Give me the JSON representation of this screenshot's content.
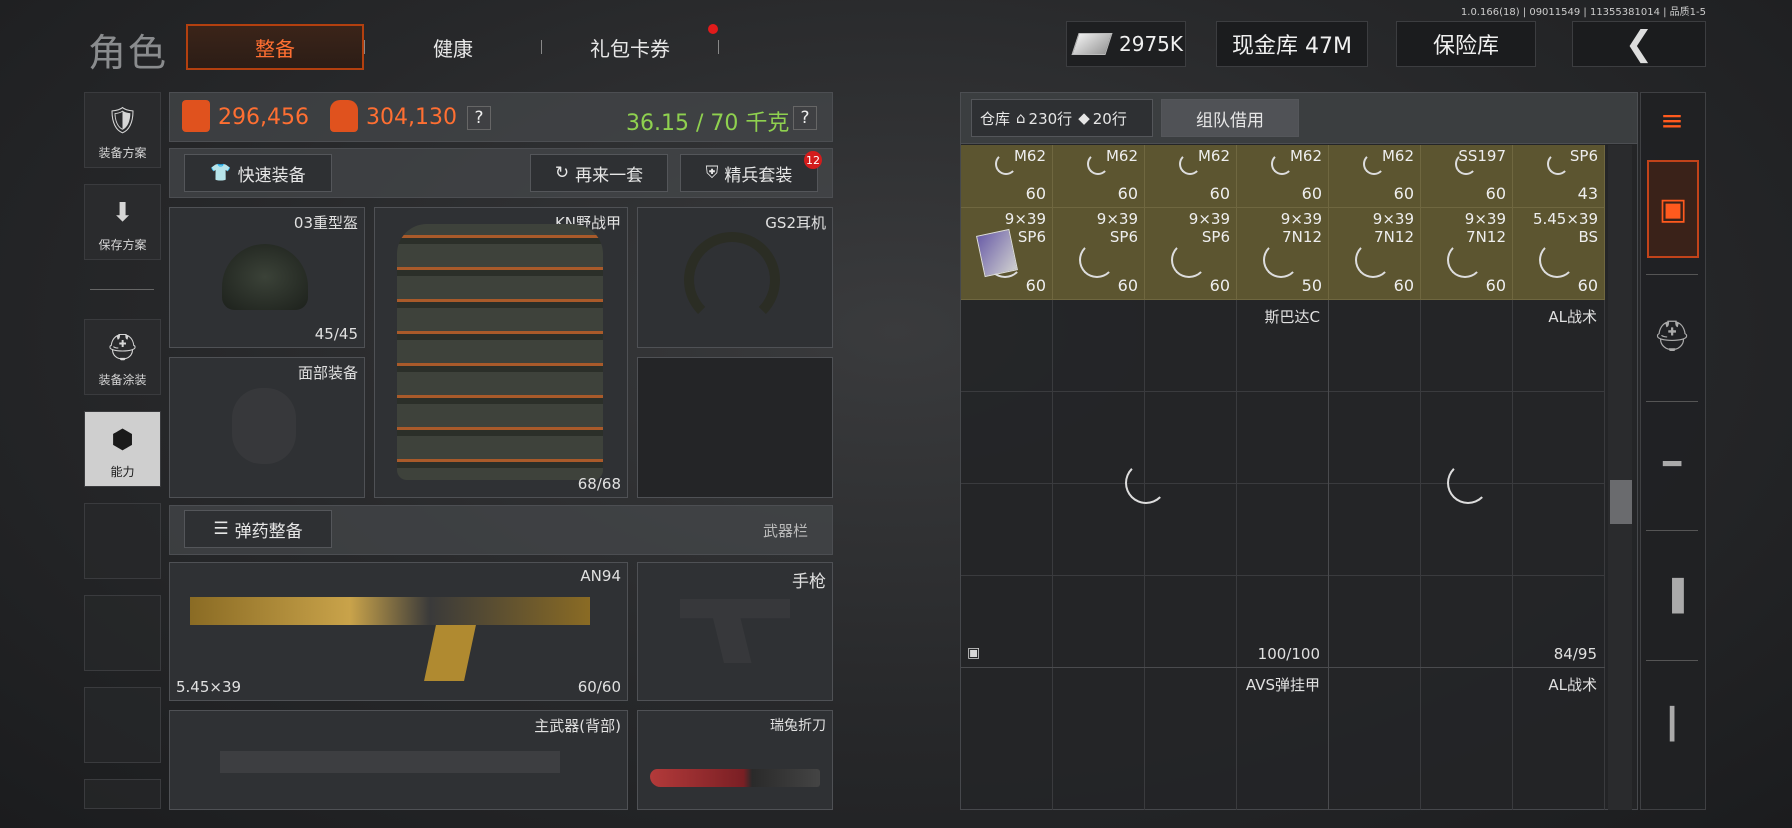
{
  "version": "1.0.166(18) | 09011549 | 11355381014 | 品质1-5",
  "title": "角色",
  "tabs": [
    {
      "label": "整备",
      "active": true
    },
    {
      "label": "健康",
      "active": false
    },
    {
      "label": "礼包卡券",
      "active": false
    }
  ],
  "currency": {
    "money": "2975K",
    "cash_vault": "现金库 47M",
    "safe": "保险库"
  },
  "left_menu": [
    {
      "label": "装备方案",
      "icon": "armor-vest-icon"
    },
    {
      "label": "保存方案",
      "icon": "download-icon"
    },
    {
      "label": "装备涂装",
      "icon": "helmet-paint-icon"
    },
    {
      "label": "能力",
      "icon": "ability-icon",
      "active": true
    }
  ],
  "stats": {
    "armor_value": "296,456",
    "bag_value": "304,130",
    "weight": "36.15 / 70 千克",
    "help": "?"
  },
  "actions": {
    "quick_equip": "快速装备",
    "again": "再来一套",
    "elite_set": "精兵套装",
    "elite_badge": "12"
  },
  "gear": {
    "helmet": {
      "name": "03重型盔",
      "durability": "45/45"
    },
    "vest": {
      "name": "KN野战甲",
      "durability": "68/68"
    },
    "headset": {
      "name": "GS2耳机"
    },
    "face": {
      "name": "面部装备"
    }
  },
  "ammo_section": {
    "button": "弹药整备",
    "label": "武器栏"
  },
  "weapons": {
    "primary": {
      "name": "AN94",
      "caliber": "5.45×39",
      "ammo": "60/60"
    },
    "pistol": {
      "name": "手枪"
    },
    "back": {
      "name": "主武器(背部)"
    },
    "knife": {
      "name": "瑞兔折刀"
    }
  },
  "storage": {
    "title": "仓库",
    "rows_home": "230行",
    "rows_ticket": "20行",
    "team_borrow": "组队借用",
    "ammo_row1": [
      {
        "type": "M62",
        "count": "60"
      },
      {
        "type": "M62",
        "count": "60"
      },
      {
        "type": "M62",
        "count": "60"
      },
      {
        "type": "M62",
        "count": "60"
      },
      {
        "type": "M62",
        "count": "60"
      },
      {
        "type": "SS197",
        "count": "60"
      },
      {
        "type": "SP6",
        "count": "43"
      }
    ],
    "ammo_row2": [
      {
        "caliber": "9×39",
        "type": "SP6",
        "count": "60"
      },
      {
        "caliber": "9×39",
        "type": "SP6",
        "count": "60"
      },
      {
        "caliber": "9×39",
        "type": "SP6",
        "count": "60"
      },
      {
        "caliber": "9×39",
        "type": "7N12",
        "count": "50"
      },
      {
        "caliber": "9×39",
        "type": "7N12",
        "count": "60"
      },
      {
        "caliber": "9×39",
        "type": "7N12",
        "count": "60"
      },
      {
        "caliber": "5.45×39",
        "type": "BS",
        "count": "60"
      }
    ],
    "items": [
      {
        "name": "斯巴达C",
        "durability": "100/100"
      },
      {
        "name": "AL战术",
        "durability": "84/95"
      },
      {
        "name": "AVS弹挂甲"
      },
      {
        "name": "AL战术"
      }
    ]
  },
  "right_tools": [
    "sort-stack-icon",
    "storage-box-icon",
    "helmet-filter-icon",
    "rifle-filter-icon",
    "magazine-filter-icon",
    "bullet-filter-icon"
  ],
  "colors": {
    "accent": "#ff6f32",
    "gold_cell": "#5c5530",
    "weight_green": "#8fd14f"
  }
}
